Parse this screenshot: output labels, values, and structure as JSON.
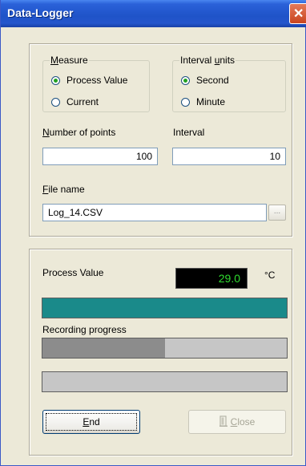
{
  "window": {
    "title": "Data-Logger"
  },
  "measure": {
    "legend_prefix": "",
    "legend_mnemonic": "M",
    "legend_rest": "easure",
    "options": [
      {
        "label": "Process Value",
        "checked": true
      },
      {
        "label": "Current",
        "checked": false
      }
    ]
  },
  "interval_units": {
    "legend_prefix": "Interval ",
    "legend_mnemonic": "u",
    "legend_rest": "nits",
    "options": [
      {
        "label": "Second",
        "checked": true
      },
      {
        "label": "Minute",
        "checked": false
      }
    ]
  },
  "number_of_points": {
    "label_mnemonic": "N",
    "label_rest": "umber of points",
    "value": "100"
  },
  "interval": {
    "label": "Interval",
    "value": "10"
  },
  "file_name": {
    "label_mnemonic": "F",
    "label_rest": "ile name",
    "value": "Log_14.CSV",
    "browse_label": "..."
  },
  "process_value": {
    "label": "Process Value",
    "reading": "29.0",
    "unit": "°C"
  },
  "recording": {
    "label": "Recording progress",
    "progress_fraction": 0.5
  },
  "colors": {
    "value_bar": "#1a8a8a",
    "progress_fill": "#8c8c8c",
    "progress_track": "#c6c6c6",
    "lcd_text": "#2fdc2f"
  },
  "buttons": {
    "end_mnemonic": "E",
    "end_rest": "nd",
    "close_mnemonic": "C",
    "close_rest": "lose"
  }
}
